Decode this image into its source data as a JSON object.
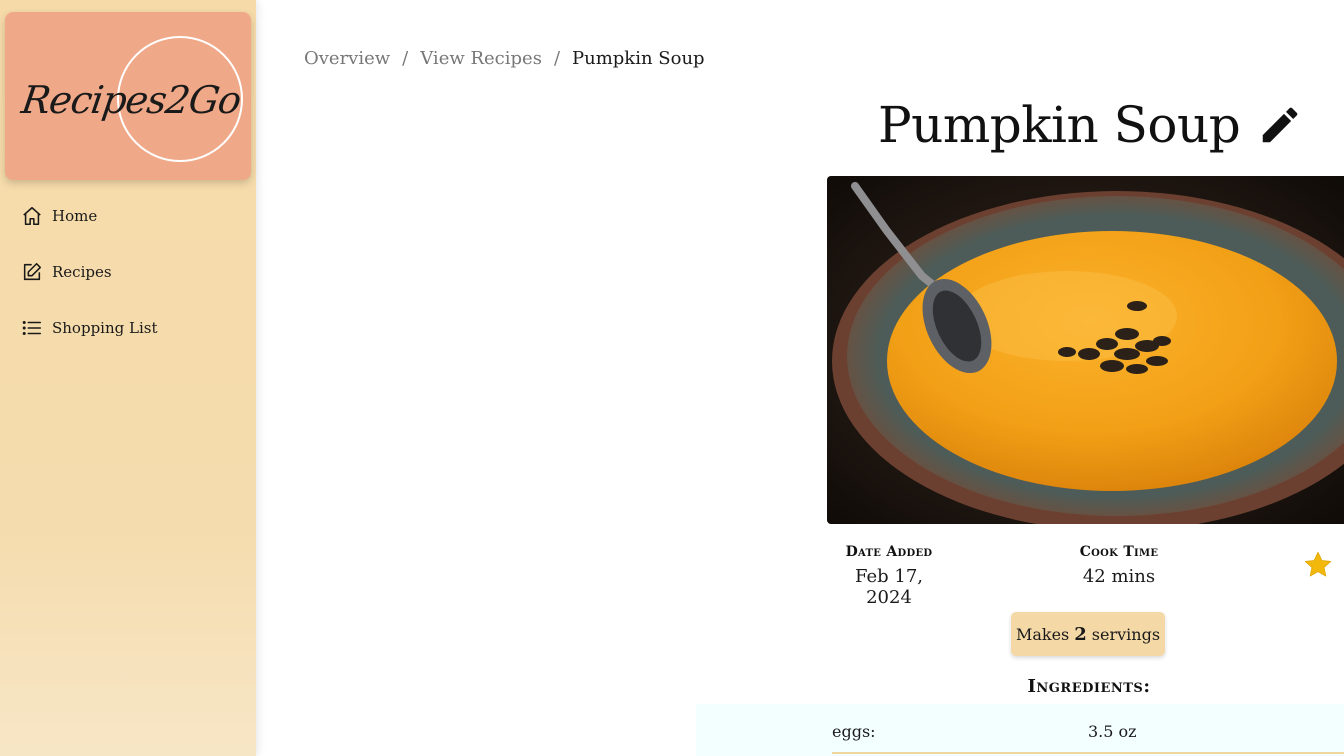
{
  "app": {
    "logo_text": "Recipes2Go",
    "colors": {
      "sidebar": "#f6dba9",
      "logo_card": "#f0a988",
      "accent_star": "#f2b90c",
      "servings_badge": "#f4d9a6"
    }
  },
  "sidebar": {
    "items": [
      {
        "label": "Home",
        "icon": "home-icon"
      },
      {
        "label": "Recipes",
        "icon": "edit-note-icon"
      },
      {
        "label": "Shopping List",
        "icon": "list-icon"
      }
    ]
  },
  "breadcrumb": {
    "items": [
      "Overview",
      "View Recipes"
    ],
    "separator": "/",
    "current": "Pumpkin Soup"
  },
  "recipe": {
    "title": "Pumpkin Soup",
    "image_alt": "bowl of pumpkin soup",
    "date_added_label": "Date Added",
    "date_added": "Feb 17, 2024",
    "cook_time_label": "Cook Time",
    "cook_time": "42 mins",
    "servings_prefix": "Makes",
    "servings_count": "2",
    "servings_suffix": "servings",
    "favorite": true,
    "ingredients_heading": "Ingredients:",
    "ingredients": [
      {
        "name": "eggs:",
        "quantity": "3.5 oz"
      }
    ]
  }
}
